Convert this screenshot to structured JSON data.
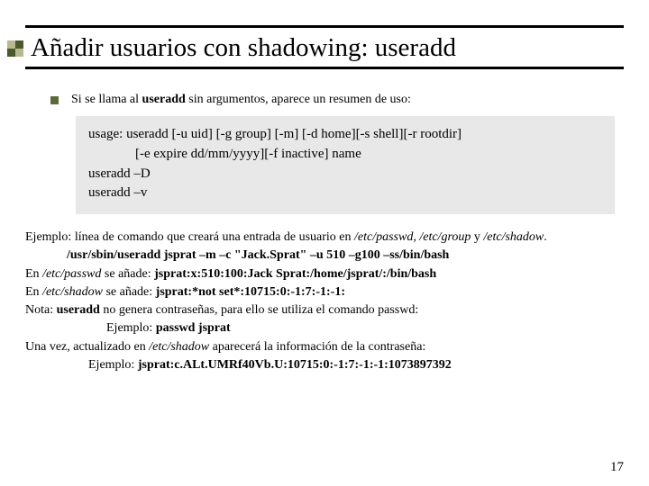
{
  "title": "Añadir usuarios con shadowing: useradd",
  "intro": {
    "prefix": "Si se llama al ",
    "bold": "useradd",
    "suffix": " sin argumentos, aparece un resumen de uso:"
  },
  "usage": {
    "l1": "usage: useradd [-u uid] [-g group] [-m] [-d home][-s shell][-r rootdir]",
    "l2": "[-e expire dd/mm/yyyy][-f inactive] name",
    "l3": "useradd –D",
    "l4": "useradd –v"
  },
  "body": {
    "ej_label": "Ejemplo:",
    "ej_text": " línea de comando que creará una entrada de usuario en ",
    "ej_files": "/etc/passwd, /etc/group",
    "ej_and": " y ",
    "ej_shadow": "/etc/shadow",
    "ej_dot": ".",
    "cmd1": "/usr/sbin/useradd jsprat –m –c \"Jack.Sprat\" –u 510 –g100 –ss/bin/bash",
    "en1a": "En ",
    "en1b": "/etc/passwd",
    "en1c": " se añade: ",
    "en1d": "jsprat:x:510:100:Jack Sprat:/home/jsprat/:/bin/bash",
    "en2a": "En ",
    "en2b": "/etc/shadow",
    "en2c": " se añade: ",
    "en2d": "jsprat:*not set*:10715:0:-1:7:-1:-1:",
    "nota_a": "Nota: ",
    "nota_b": "useradd",
    "nota_c": " no genera contraseñas, para ello se utiliza el comando passwd:",
    "ej2a": "Ejemplo: ",
    "ej2b": "passwd jsprat",
    "upd": "Una vez, actualizado en ",
    "upd_b": "/etc/shadow",
    "upd_c": " aparecerá la información de la contraseña:",
    "ej3a": "Ejemplo: ",
    "ej3b": "jsprat:c.ALt.UMRf40Vb.U:10715:0:-1:7:-1:-1:1073897392"
  },
  "page_number": "17"
}
